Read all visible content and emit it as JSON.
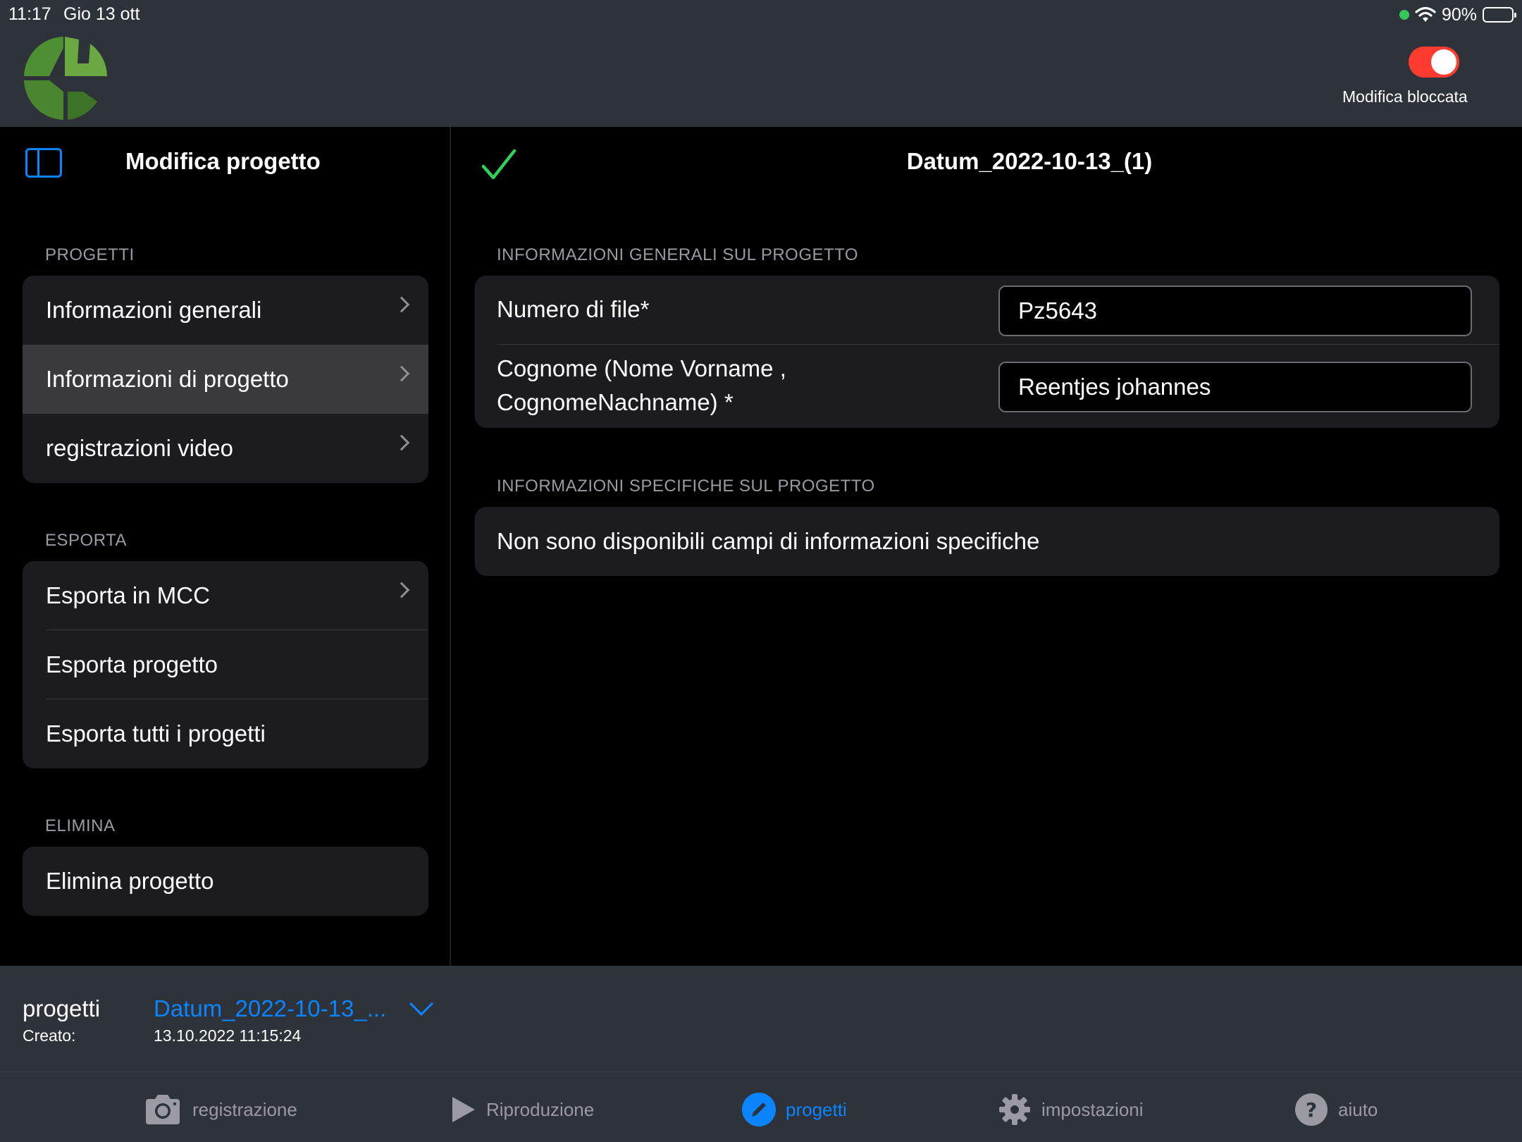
{
  "status_bar": {
    "time": "11:17",
    "date": "Gio 13 ott",
    "battery": "90%",
    "battery_level": 0.9
  },
  "header": {
    "toggle_label": "Modifica bloccata",
    "toggle_on": true
  },
  "sidebar": {
    "title": "Modifica progetto",
    "sections": [
      {
        "title": "PROGETTI",
        "items": [
          "Informazioni generali",
          "Informazioni di progetto",
          "registrazioni video"
        ]
      },
      {
        "title": "ESPORTA",
        "items": [
          "Esporta in MCC",
          "Esporta progetto",
          "Esporta tutti i progetti"
        ]
      },
      {
        "title": "ELIMINA",
        "items": [
          "Elimina progetto"
        ]
      }
    ]
  },
  "main": {
    "title": "Datum_2022-10-13_(1)",
    "general_section": {
      "title": "INFORMAZIONI GENERALI SUL PROGETTO",
      "fields": [
        {
          "label": "Numero di file*",
          "value": "Pz5643"
        },
        {
          "label_line1": "Cognome (Nome Vorname ,",
          "label_line2": "CognomeNachname) *",
          "value": "Reentjes johannes"
        }
      ]
    },
    "specific_section": {
      "title": "INFORMAZIONI SPECIFICHE SUL PROGETTO",
      "empty_text": "Non sono disponibili campi di informazioni specifiche"
    }
  },
  "project_bar": {
    "label": "progetti",
    "created_label": "Creato:",
    "project_name": "Datum_2022-10-13_...",
    "created_date": "13.10.2022 11:15:24"
  },
  "tabs": [
    {
      "label": "registrazione",
      "icon": "camera-icon"
    },
    {
      "label": "Riproduzione",
      "icon": "play-icon"
    },
    {
      "label": "progetti",
      "icon": "pencil-icon",
      "active": true
    },
    {
      "label": "impostazioni",
      "icon": "gear-icon"
    },
    {
      "label": "aiuto",
      "icon": "question-icon"
    }
  ],
  "colors": {
    "accent": "#0a84ff",
    "toggle_on": "#ff3b30",
    "check": "#30d158",
    "logo_green": "#5a9a3a"
  }
}
